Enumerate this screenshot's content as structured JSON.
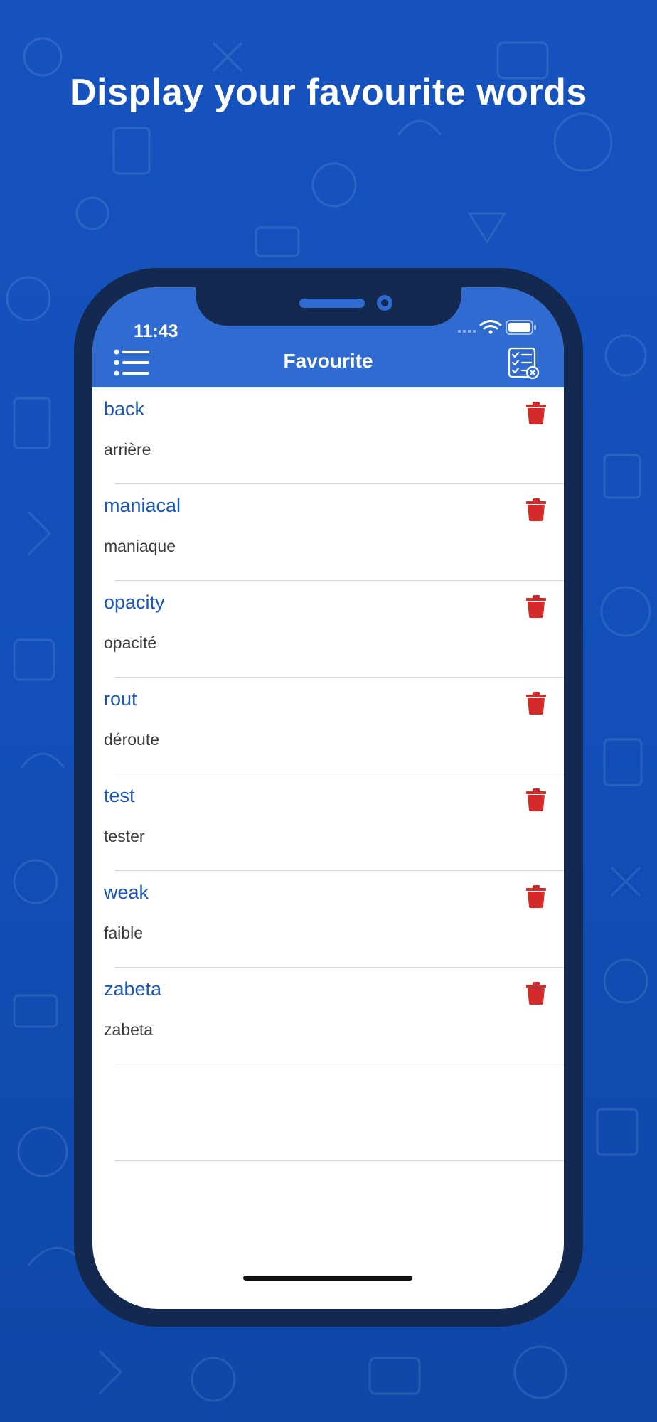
{
  "headline": "Display your favourite words",
  "status_bar": {
    "time": "11:43"
  },
  "nav": {
    "title": "Favourite",
    "menu_icon": "menu-list-icon",
    "clear_icon": "checklist-clear-icon"
  },
  "colors": {
    "background": "#1753bf",
    "nav_bar": "#2f6bd0",
    "word": "#1a57b8",
    "translation": "#3a3a3a",
    "delete": "#d42a2a",
    "phone_frame": "#13294f"
  },
  "favourites": [
    {
      "word": "back",
      "translation": "arrière"
    },
    {
      "word": "maniacal",
      "translation": "maniaque"
    },
    {
      "word": "opacity",
      "translation": "opacité"
    },
    {
      "word": "rout",
      "translation": "déroute"
    },
    {
      "word": "test",
      "translation": "tester"
    },
    {
      "word": "weak",
      "translation": "faible"
    },
    {
      "word": "zabeta",
      "translation": "zabeta"
    }
  ]
}
